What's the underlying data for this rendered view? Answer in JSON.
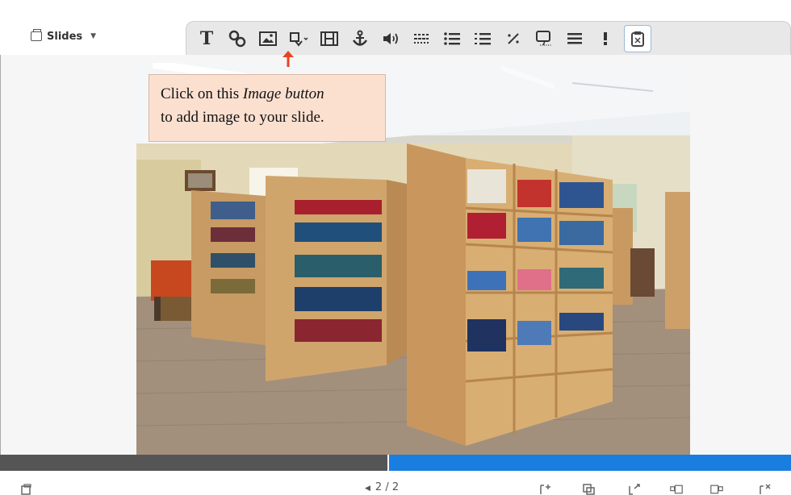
{
  "header": {
    "slides_menu_label": "Slides",
    "toolbar_text_button": "T"
  },
  "toolbar_icons": [
    "text-icon",
    "link-icon",
    "image-icon",
    "shape-icon",
    "video-icon",
    "anchor-icon",
    "audio-icon",
    "chart-icon",
    "bulleted-list-icon",
    "numbered-list-icon",
    "math-icon",
    "speech-bubble-icon",
    "menu-icon",
    "more-vertical-icon",
    "layout-icon"
  ],
  "callout": {
    "line1_start": "Click on this ",
    "line1_em": "Image button",
    "line2": "to add image to your slide."
  },
  "footer": {
    "pager": "2 / 2",
    "progress": 0.51
  },
  "colors": {
    "callout_bg": "#fbe0d0",
    "arrow": "#e8431f",
    "progress_fill": "#1a7de0",
    "progress_track": "#555555"
  }
}
